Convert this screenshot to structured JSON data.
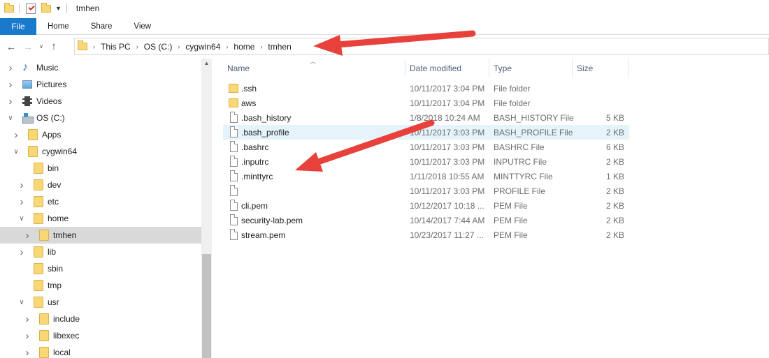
{
  "window": {
    "title": "tmhen"
  },
  "ribbon": {
    "tabs": [
      "File",
      "Home",
      "Share",
      "View"
    ]
  },
  "address": {
    "crumbs": [
      "This PC",
      "OS (C:)",
      "cygwin64",
      "home",
      "tmhen"
    ]
  },
  "sidebar": {
    "items": [
      {
        "label": "Music",
        "icon": "music-icon",
        "expand": "collapsed",
        "level": 0
      },
      {
        "label": "Pictures",
        "icon": "pictures-icon",
        "expand": "collapsed",
        "level": 0
      },
      {
        "label": "Videos",
        "icon": "videos-icon",
        "expand": "collapsed",
        "level": 0
      },
      {
        "label": "OS (C:)",
        "icon": "drive-icon",
        "expand": "expanded",
        "level": 0
      },
      {
        "label": "Apps",
        "icon": "folder-icon",
        "expand": "collapsed",
        "level": 1
      },
      {
        "label": "cygwin64",
        "icon": "folder-icon",
        "expand": "expanded",
        "level": 1
      },
      {
        "label": "bin",
        "icon": "folder-icon",
        "expand": "none",
        "level": 2
      },
      {
        "label": "dev",
        "icon": "folder-icon",
        "expand": "collapsed",
        "level": 2
      },
      {
        "label": "etc",
        "icon": "folder-icon",
        "expand": "collapsed",
        "level": 2
      },
      {
        "label": "home",
        "icon": "folder-icon",
        "expand": "expanded",
        "level": 2
      },
      {
        "label": "tmhen",
        "icon": "folder-icon",
        "expand": "collapsed",
        "level": 3,
        "selected": true
      },
      {
        "label": "lib",
        "icon": "folder-icon",
        "expand": "collapsed",
        "level": 2
      },
      {
        "label": "sbin",
        "icon": "folder-icon",
        "expand": "none",
        "level": 2
      },
      {
        "label": "tmp",
        "icon": "folder-icon",
        "expand": "none",
        "level": 2
      },
      {
        "label": "usr",
        "icon": "folder-icon",
        "expand": "expanded",
        "level": 2
      },
      {
        "label": "include",
        "icon": "folder-icon",
        "expand": "collapsed",
        "level": 3
      },
      {
        "label": "libexec",
        "icon": "folder-icon",
        "expand": "collapsed",
        "level": 3
      },
      {
        "label": "local",
        "icon": "folder-icon",
        "expand": "collapsed",
        "level": 3
      }
    ]
  },
  "columns": {
    "name": "Name",
    "date": "Date modified",
    "type": "Type",
    "size": "Size"
  },
  "files": [
    {
      "name": ".ssh",
      "date": "10/11/2017 3:04 PM",
      "type": "File folder",
      "size": "",
      "icon": "folder-icon"
    },
    {
      "name": "aws",
      "date": "10/11/2017 3:04 PM",
      "type": "File folder",
      "size": "",
      "icon": "folder-icon"
    },
    {
      "name": ".bash_history",
      "date": "1/8/2018 10:24 AM",
      "type": "BASH_HISTORY File",
      "size": "5 KB",
      "icon": "file-icon"
    },
    {
      "name": ".bash_profile",
      "date": "10/11/2017 3:03 PM",
      "type": "BASH_PROFILE File",
      "size": "2 KB",
      "icon": "file-icon",
      "hover": true
    },
    {
      "name": ".bashrc",
      "date": "10/11/2017 3:03 PM",
      "type": "BASHRC File",
      "size": "6 KB",
      "icon": "file-icon"
    },
    {
      "name": ".inputrc",
      "date": "10/11/2017 3:03 PM",
      "type": "INPUTRC File",
      "size": "2 KB",
      "icon": "file-icon"
    },
    {
      "name": ".minttyrc",
      "date": "1/11/2018 10:55 AM",
      "type": "MINTTYRC File",
      "size": "1 KB",
      "icon": "file-icon"
    },
    {
      "name": "",
      "date": "10/11/2017 3:03 PM",
      "type": "PROFILE File",
      "size": "2 KB",
      "icon": "file-icon"
    },
    {
      "name": "cli.pem",
      "date": "10/12/2017 10:18 ...",
      "type": "PEM File",
      "size": "2 KB",
      "icon": "file-icon"
    },
    {
      "name": "security-lab.pem",
      "date": "10/14/2017 7:44 AM",
      "type": "PEM File",
      "size": "2 KB",
      "icon": "file-icon"
    },
    {
      "name": "stream.pem",
      "date": "10/23/2017 11:27 ...",
      "type": "PEM File",
      "size": "2 KB",
      "icon": "file-icon"
    }
  ],
  "colors": {
    "file_tab": "#1979ca",
    "annotation_arrow": "#e8413b",
    "selection": "#d9d9d9",
    "hover": "#e5f3fb"
  }
}
